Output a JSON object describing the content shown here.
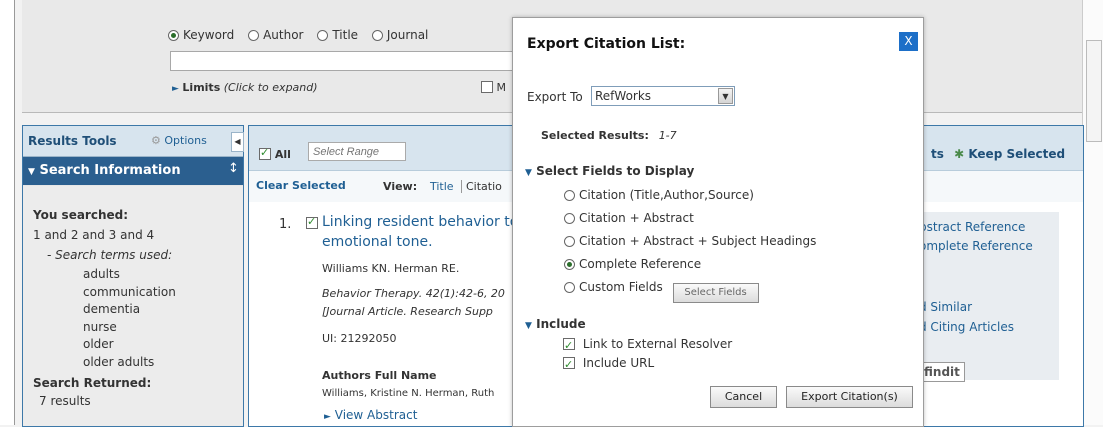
{
  "search": {
    "field_options": [
      "Keyword",
      "Author",
      "Title",
      "Journal"
    ],
    "selected_option": "Keyword",
    "limits_label": "Limits",
    "limits_hint": "(Click to expand)",
    "partial_checkbox_label": "M"
  },
  "tools": {
    "title": "Results Tools",
    "options_label": "Options",
    "search_info_title": "Search Information",
    "you_searched_label": "You searched:",
    "query": "1 and 2 and 3 and 4",
    "terms_label": "- Search terms used:",
    "terms": [
      "adults",
      "communication",
      "dementia",
      "nurse",
      "older",
      "older adults"
    ],
    "returned_label": "Search Returned:",
    "returned_value": "7 results"
  },
  "results": {
    "all_label": "All",
    "range_placeholder": "Select Range",
    "clear_selected": "Clear Selected",
    "view_label": "View:",
    "view_title": "Title",
    "view_citation": "Citatio",
    "right_links_partial": "ts",
    "keep_selected": "Keep Selected",
    "item": {
      "number": "1.",
      "title_line1": "Linking resident behavior to",
      "title_line2": "emotional tone.",
      "authors": "Williams KN. Herman RE.",
      "source_line1": "Behavior Therapy. 42(1):42-6, 20",
      "source_line2": "[Journal Article. Research Supp",
      "ui": "UI: 21292050",
      "authors_full_label": "Authors Full Name",
      "authors_full": "Williams, Kristine N. Herman, Ruth",
      "view_abstract": "View Abstract"
    },
    "side_links": [
      "bstract Reference",
      "omplete Reference",
      "d Similar",
      "d Citing Articles"
    ],
    "findit": "findit"
  },
  "modal": {
    "title": "Export Citation List:",
    "close_label": "X",
    "export_to_label": "Export To",
    "export_to_value": "RefWorks",
    "selected_results_label": "Selected Results:",
    "selected_results_value": "1-7",
    "fields_section": "Select Fields to Display",
    "field_options": [
      "Citation (Title,Author,Source)",
      "Citation + Abstract",
      "Citation + Abstract + Subject Headings",
      "Complete Reference",
      "Custom Fields"
    ],
    "selected_field": "Complete Reference",
    "select_fields_button": "Select Fields",
    "include_section": "Include",
    "include_options": [
      "Link to External Resolver",
      "Include URL"
    ],
    "cancel_button": "Cancel",
    "export_button": "Export Citation(s)"
  }
}
